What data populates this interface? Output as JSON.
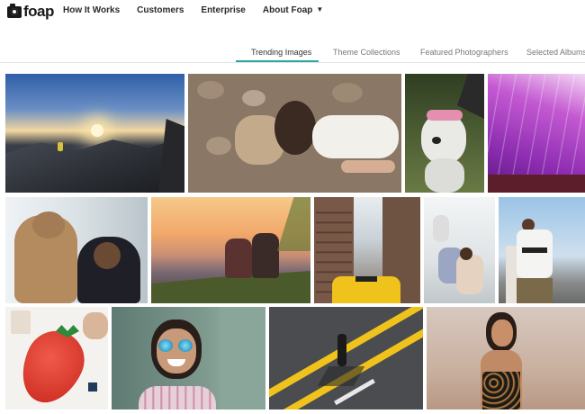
{
  "brand": {
    "logo_text": "foap"
  },
  "nav": {
    "items": [
      "How It Works",
      "Customers",
      "Enterprise",
      "About Foap"
    ],
    "dropdown_icon": "chevron-down-icon"
  },
  "tabs": {
    "items": [
      "Trending Images",
      "Theme Collections",
      "Featured Photographers",
      "Selected Albums"
    ],
    "active": "Trending Images",
    "accent_color": "#2aa8a8"
  },
  "photos": [
    {
      "subject": "mountain-sunset-hiker",
      "row": 1
    },
    {
      "subject": "woman-lying-on-rocks",
      "row": 1
    },
    {
      "subject": "dog-with-flower-crown",
      "row": 1
    },
    {
      "subject": "purple-building-facade",
      "row": 1
    },
    {
      "subject": "woman-hugging-dog",
      "row": 2
    },
    {
      "subject": "couple-sunset-guitar",
      "row": 2
    },
    {
      "subject": "city-street-taxi",
      "row": 2
    },
    {
      "subject": "friends-sitting-wall",
      "row": 2
    },
    {
      "subject": "man-supreme-shirt",
      "row": 2
    },
    {
      "subject": "watercolor-strawberry",
      "row": 3
    },
    {
      "subject": "smiling-woman-sunglasses",
      "row": 3
    },
    {
      "subject": "skateboarder-crosswalk",
      "row": 3
    },
    {
      "subject": "woman-at-beach",
      "row": 3
    }
  ]
}
